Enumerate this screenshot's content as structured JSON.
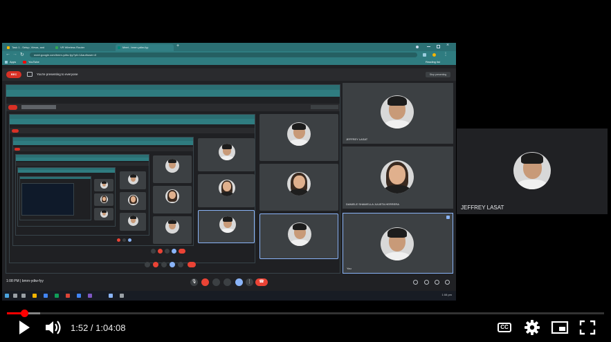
{
  "browser": {
    "tabs": [
      {
        "label": "Task 1 - Setup, Views, and Layou...",
        "favicon_color": "#fbbc04"
      },
      {
        "label": "VR Wireless Router",
        "favicon_color": "#34a853"
      },
      {
        "label": "Meet - bmrn-ydiw-fyy",
        "favicon_color": "#00897b"
      }
    ],
    "new_tab": "+",
    "url": "meet.google.com/bmrn-ydiw-fyy?pli=1&authuser=0",
    "bookmarks": [
      "Apps",
      "YouTube"
    ],
    "reading_list": "Reading list"
  },
  "meet": {
    "rec_label": "REC",
    "presenting_text": "You're presenting to everyone",
    "stop_label": "Stop presenting",
    "time_label": "1:08 PM",
    "meeting_code": "bmrn-ydiw-fyy",
    "participants": [
      {
        "name": "JEFFREY LASAT"
      },
      {
        "name": "DANIELE SHAWELLA JULIETA HERRERA"
      },
      {
        "name": "You"
      }
    ],
    "taskbar_clock": "1:08 pm"
  },
  "self_view": {
    "name": "JEFFREY LASAT"
  },
  "player": {
    "current_time": "1:52",
    "separator": " / ",
    "duration": "1:04:08",
    "time_text": "1:52 / 1:04:08",
    "progress_fraction": 0.029,
    "cc_label": "CC"
  },
  "colors": {
    "accent": "#ff0000",
    "meet_teal": "#2b6f73",
    "tile_bg": "#3c4043"
  }
}
